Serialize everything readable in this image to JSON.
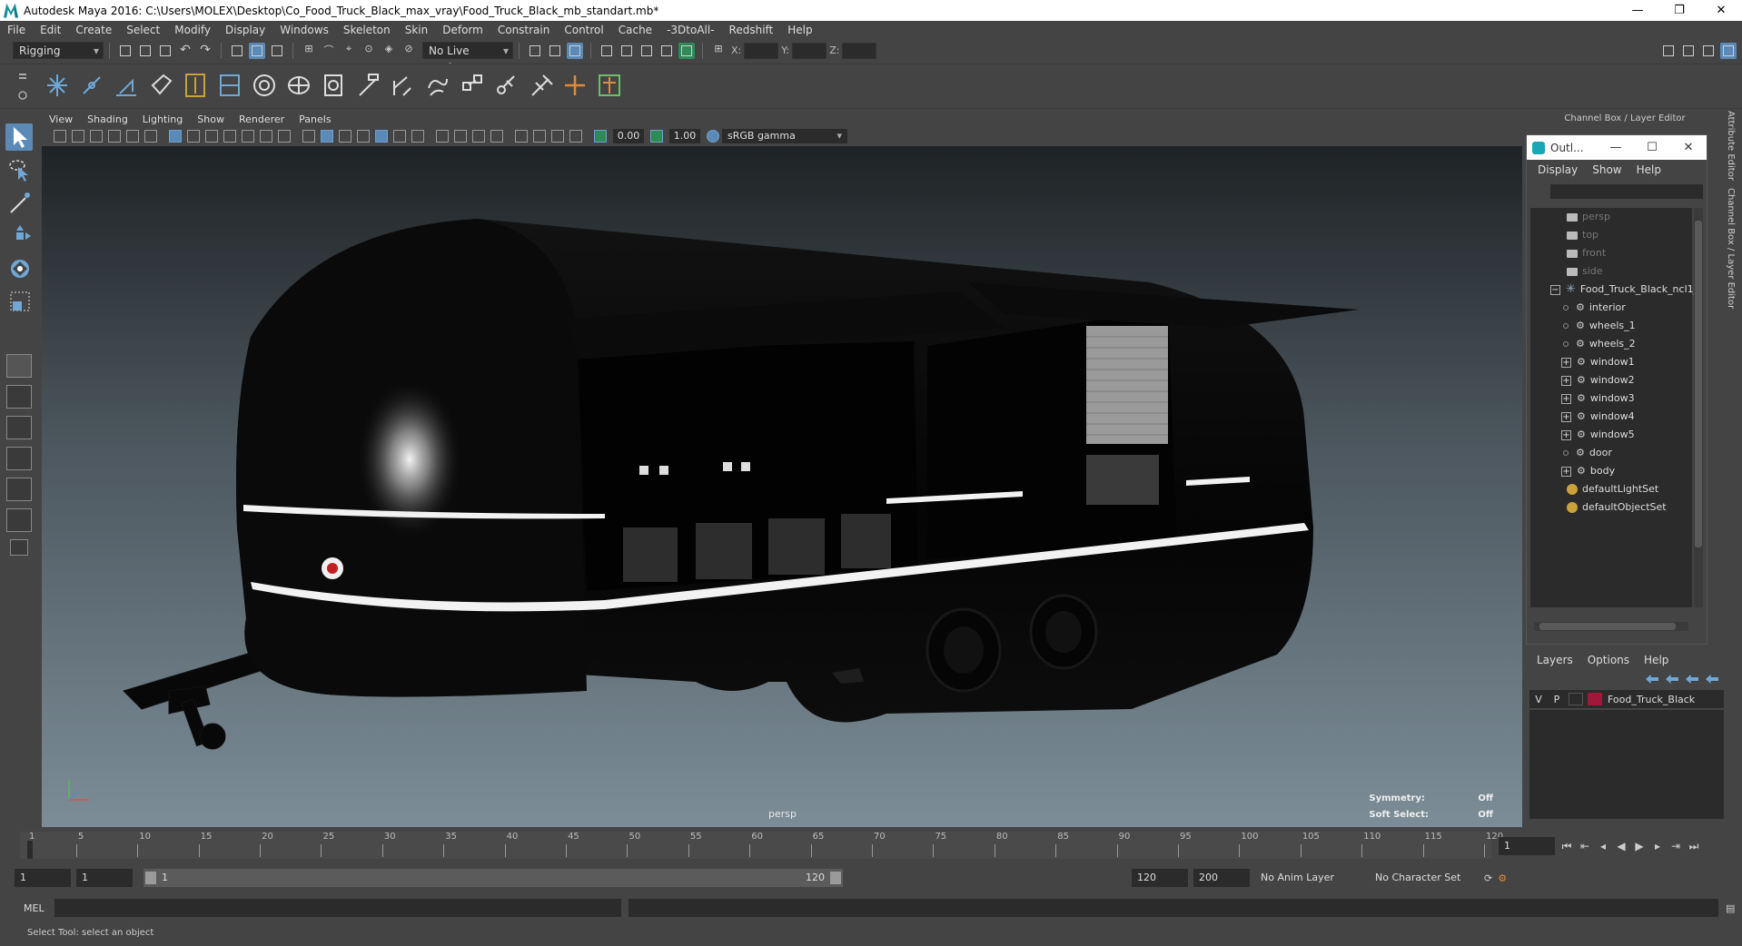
{
  "window": {
    "title": "Autodesk Maya 2016: C:\\Users\\MOLEX\\Desktop\\Co_Food_Truck_Black_max_vray\\Food_Truck_Black_mb_standart.mb*"
  },
  "menubar": [
    "File",
    "Edit",
    "Create",
    "Select",
    "Modify",
    "Display",
    "Windows",
    "Skeleton",
    "Skin",
    "Deform",
    "Constrain",
    "Control",
    "Cache",
    "-3DtoAll-",
    "Redshift",
    "Help"
  ],
  "statusline": {
    "mode": "Rigging",
    "live_surface": "No Live Surface",
    "x_label": "X:",
    "y_label": "Y:",
    "z_label": "Z:"
  },
  "viewport": {
    "menu": [
      "View",
      "Shading",
      "Lighting",
      "Show",
      "Renderer",
      "Panels"
    ],
    "exposure": "0.00",
    "gamma_value": "1.00",
    "color_space": "sRGB gamma",
    "camera_label": "persp",
    "symmetry_label": "Symmetry:",
    "symmetry_value": "Off",
    "soft_select_label": "Soft Select:",
    "soft_select_value": "Off"
  },
  "channel_box": {
    "header": "Channel Box / Layer Editor"
  },
  "outliner": {
    "title": "Outl...",
    "menu": [
      "Display",
      "Show",
      "Help"
    ],
    "items": [
      {
        "label": "persp",
        "kind": "camera",
        "depth": 0,
        "dim": true
      },
      {
        "label": "top",
        "kind": "camera",
        "depth": 0,
        "dim": true
      },
      {
        "label": "front",
        "kind": "camera",
        "depth": 0,
        "dim": true
      },
      {
        "label": "side",
        "kind": "camera",
        "depth": 0,
        "dim": true
      },
      {
        "label": "Food_Truck_Black_ncl1_",
        "kind": "group",
        "depth": 0,
        "expander": "−"
      },
      {
        "label": "interior",
        "kind": "mesh",
        "depth": 1
      },
      {
        "label": "wheels_1",
        "kind": "mesh",
        "depth": 1
      },
      {
        "label": "wheels_2",
        "kind": "mesh",
        "depth": 1
      },
      {
        "label": "window1",
        "kind": "mesh",
        "depth": 1,
        "expander": "+"
      },
      {
        "label": "window2",
        "kind": "mesh",
        "depth": 1,
        "expander": "+"
      },
      {
        "label": "window3",
        "kind": "mesh",
        "depth": 1,
        "expander": "+"
      },
      {
        "label": "window4",
        "kind": "mesh",
        "depth": 1,
        "expander": "+"
      },
      {
        "label": "window5",
        "kind": "mesh",
        "depth": 1,
        "expander": "+"
      },
      {
        "label": "door",
        "kind": "mesh",
        "depth": 1
      },
      {
        "label": "body",
        "kind": "mesh",
        "depth": 1,
        "expander": "+"
      },
      {
        "label": "defaultLightSet",
        "kind": "set",
        "depth": 0
      },
      {
        "label": "defaultObjectSet",
        "kind": "set",
        "depth": 0
      }
    ]
  },
  "layers": {
    "menu": [
      "Layers",
      "Options",
      "Help"
    ],
    "rows": [
      {
        "v": "V",
        "p": "P",
        "name": "Food_Truck_Black",
        "color": "#a0173a"
      }
    ]
  },
  "side_tabs": [
    "Attribute Editor",
    "Channel Box / Layer Editor"
  ],
  "timeline": {
    "ticks": [
      1,
      5,
      10,
      15,
      20,
      25,
      30,
      35,
      40,
      45,
      50,
      55,
      60,
      65,
      70,
      75,
      80,
      85,
      90,
      95,
      100,
      105,
      110,
      115,
      120
    ],
    "min": 1,
    "max": 120,
    "current_frame": "1"
  },
  "range": {
    "start": "1",
    "anim_start": "1",
    "range_start": "1",
    "range_end": "120",
    "anim_end": "120",
    "end": "200",
    "anim_layer": "No Anim Layer",
    "character_set": "No Character Set"
  },
  "commandline": {
    "mel_label": "MEL"
  },
  "helpline": {
    "text": "Select Tool: select an object"
  },
  "colors": {
    "accent": "#5b8ab6",
    "layer_color": "#a0173a"
  }
}
